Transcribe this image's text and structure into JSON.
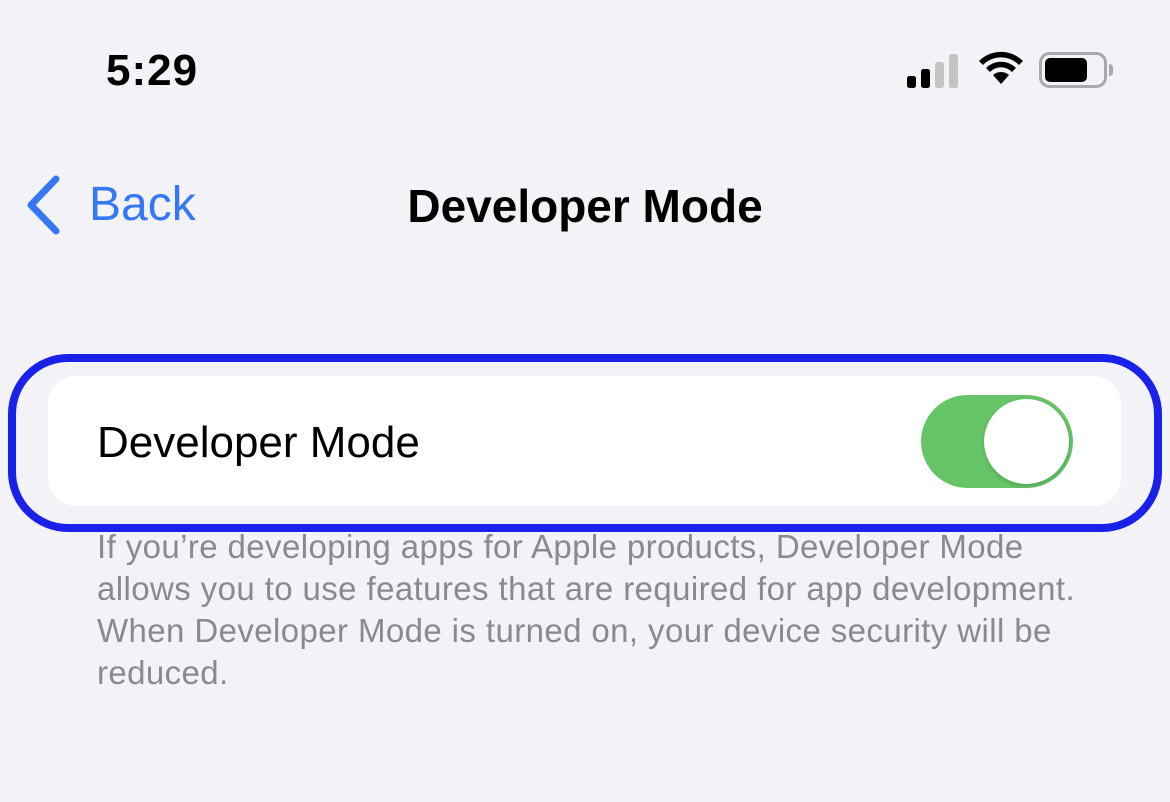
{
  "status_bar": {
    "time": "5:29",
    "signal_icon": "cellular-signal-icon",
    "wifi_icon": "wifi-icon",
    "battery_icon": "battery-icon"
  },
  "nav": {
    "back_label": "Back",
    "back_icon": "chevron-left-icon",
    "title": "Developer Mode"
  },
  "settings": {
    "row_label": "Developer Mode",
    "toggle_state": "on",
    "footer": "If you’re developing apps for Apple products, Developer Mode allows you to use features that are required for app development. When Developer Mode is turned on, your device security will be reduced."
  },
  "colors": {
    "accent": "#3478f6",
    "toggle_on": "#65c466",
    "highlight": "#1a22ea",
    "background": "#f2f2f7"
  }
}
